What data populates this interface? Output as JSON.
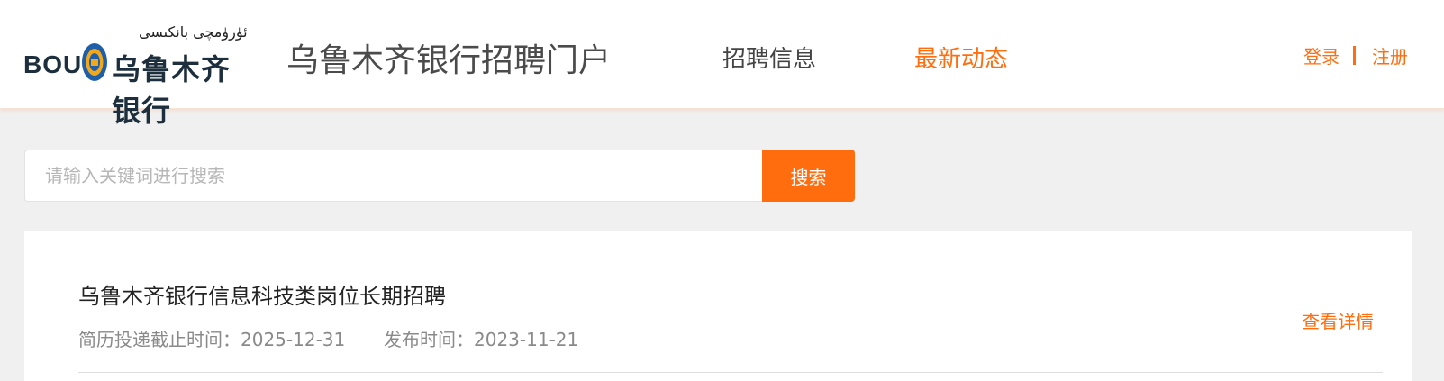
{
  "header": {
    "logo": {
      "script_text": "ئۈرۈمچى بانكىسى",
      "abbr": "BOU",
      "cn_name": "乌鲁木齐银行"
    },
    "portal_title": "乌鲁木齐银行招聘门户",
    "nav": [
      {
        "label": "招聘信息",
        "active": false
      },
      {
        "label": "最新动态",
        "active": true
      }
    ],
    "login_label": "登录",
    "register_label": "注册"
  },
  "search": {
    "placeholder": "请输入关键词进行搜索",
    "value": "",
    "button_label": "搜索"
  },
  "jobs": [
    {
      "title": "乌鲁木齐银行信息科技类岗位长期招聘",
      "deadline_label": "简历投递截止时间：",
      "deadline": "2025-12-31",
      "publish_label": "发布时间：",
      "publish_date": "2023-11-21",
      "detail_label": "查看详情"
    }
  ],
  "colors": {
    "accent": "#ff6d0f",
    "background": "#f0f0f0",
    "brand_dark": "#1d2f3c",
    "emblem_blue": "#1f5fa8",
    "emblem_gold": "#f2a81d"
  }
}
